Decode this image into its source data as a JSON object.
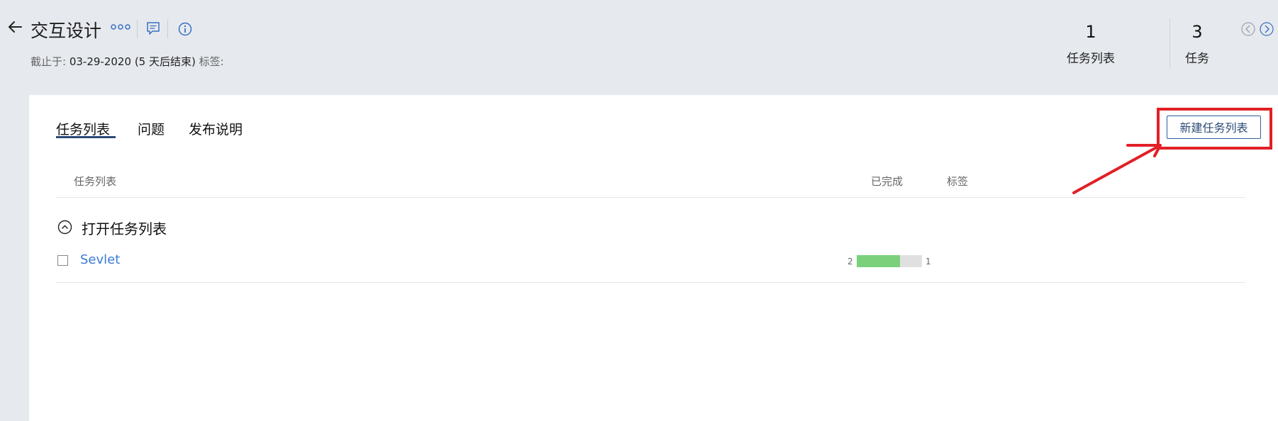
{
  "header": {
    "title": "交互设计",
    "due_label": "截止于:",
    "due_date": "03-29-2020",
    "due_note": "(5 天后结束)",
    "tags_label": "标签:"
  },
  "stats": [
    {
      "value": "1",
      "label": "任务列表"
    },
    {
      "value": "3",
      "label": "任务"
    }
  ],
  "tabs": [
    {
      "label": "任务列表",
      "active": true
    },
    {
      "label": "问题",
      "active": false
    },
    {
      "label": "发布说明",
      "active": false
    }
  ],
  "toolbar": {
    "new_tasklist_label": "新建任务列表"
  },
  "table": {
    "columns": [
      "任务列表",
      "已完成",
      "标签"
    ],
    "section_title": "打开任务列表",
    "rows": [
      {
        "name": "Sevlet",
        "open_count": "2",
        "done_count": "1",
        "progress_fraction": 0.667
      }
    ]
  },
  "colors": {
    "accent": "#2c4a78",
    "link": "#3a7bd5",
    "progress": "#7bd17b",
    "annotation": "#e21f26",
    "background": "#e6e9ed"
  }
}
